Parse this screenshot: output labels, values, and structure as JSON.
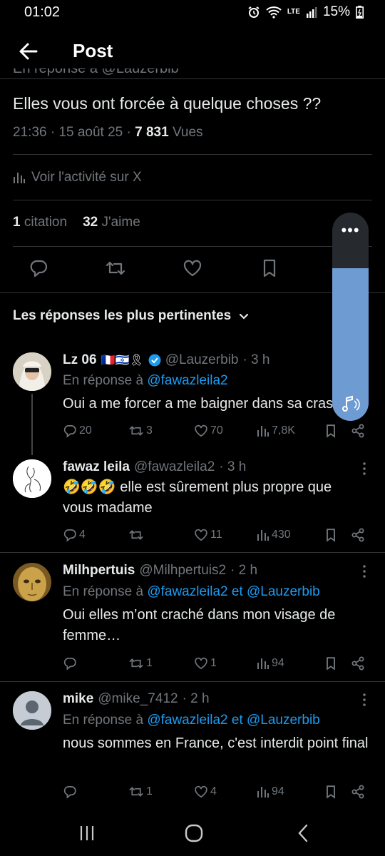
{
  "status": {
    "time": "01:02",
    "battery": "15%",
    "network": "LTE"
  },
  "header": {
    "title": "Post"
  },
  "post": {
    "replying_to_cut": "En réponse à @Lauzerbib",
    "text": "Elles vous ont forcée à quelque choses ??",
    "meta_prefix": "21:36 · 15 août 25 · ",
    "views_count": "7 831",
    "views_label": " Vues",
    "activity": "Voir l'activité sur X",
    "quote_count": "1",
    "quote_label": "citation",
    "like_count": "32",
    "like_label": "J'aime"
  },
  "sort": {
    "label": "Les réponses les plus pertinentes"
  },
  "replies": [
    {
      "name": "Lz 06",
      "emoji_flags": "🇫🇷🇮🇱🎗",
      "handle": "@Lauzerbib",
      "time": "· 3 h",
      "replying_prefix": "En réponse à ",
      "replying_to": "@fawazleila2",
      "text": "Oui a me forcer a me baigner dans sa crasse",
      "replies": "20",
      "reposts": "3",
      "likes": "70",
      "views": "7,8K"
    },
    {
      "name": "fawaz leila",
      "handle": "@fawazleila2",
      "time": "· 3 h",
      "emoji": "🤣🤣🤣",
      "text": " elle est sûrement plus propre que vous madame",
      "replies": "4",
      "reposts": "",
      "likes": "11",
      "views": "430"
    },
    {
      "name": "Milhpertuis",
      "handle": "@Milhpertuis2",
      "time": "· 2 h",
      "replying_prefix": "En réponse à ",
      "replying_to": "@fawazleila2 et @Lauzerbib",
      "text": "Oui elles m’ont craché dans mon visage de femme…",
      "replies": "",
      "reposts": "1",
      "likes": "1",
      "views": "94"
    },
    {
      "name": "mike",
      "handle": "@mike_7412",
      "time": "· 2 h",
      "replying_prefix": "En réponse à ",
      "replying_to": "@fawazleila2 et @Lauzerbib",
      "text": "nous sommes en France, c'est interdit point final",
      "replies": "",
      "reposts": "1",
      "likes": "4",
      "views": "94"
    }
  ],
  "colors": {
    "background": "#000000",
    "accent": "#1d9bf0",
    "muted": "#71767b",
    "verified": "#1d9bf0",
    "overlay": "#6e9bd2"
  },
  "icons": [
    "back-arrow-icon",
    "chart-icon",
    "reply-icon",
    "repost-icon",
    "like-icon",
    "bookmark-icon",
    "share-icon",
    "more-icon",
    "chevron-down-icon",
    "verified-icon",
    "music-note-icon"
  ]
}
